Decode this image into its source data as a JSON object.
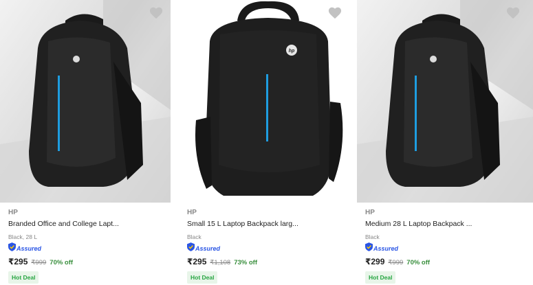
{
  "products": [
    {
      "brand": "HP",
      "title": "Branded Office and College Lapt...",
      "variant": "Black, 28 L",
      "assured": "Assured",
      "price": "₹295",
      "mrp": "₹999",
      "discount": "70% off",
      "deal": "Hot Deal"
    },
    {
      "brand": "HP",
      "title": "Small 15 L Laptop Backpack larg...",
      "variant": "Black",
      "assured": "Assured",
      "price": "₹295",
      "mrp": "₹1,108",
      "discount": "73% off",
      "deal": "Hot Deal"
    },
    {
      "brand": "HP",
      "title": "Medium 28 L Laptop Backpack ...",
      "variant": "Black",
      "assured": "Assured",
      "price": "₹299",
      "mrp": "₹999",
      "discount": "70% off",
      "deal": "Hot Deal"
    }
  ],
  "colors": {
    "price_discount": "#388e3c",
    "assured_blue": "#2a55e5",
    "deal_bg": "#e8f5e9",
    "wishlist_heart": "#c2c2c2",
    "bag_zip_blue": "#1e9de0"
  },
  "icons": {
    "wishlist": "heart-icon",
    "assured": "shield-icon",
    "logo": "hp-logo"
  }
}
